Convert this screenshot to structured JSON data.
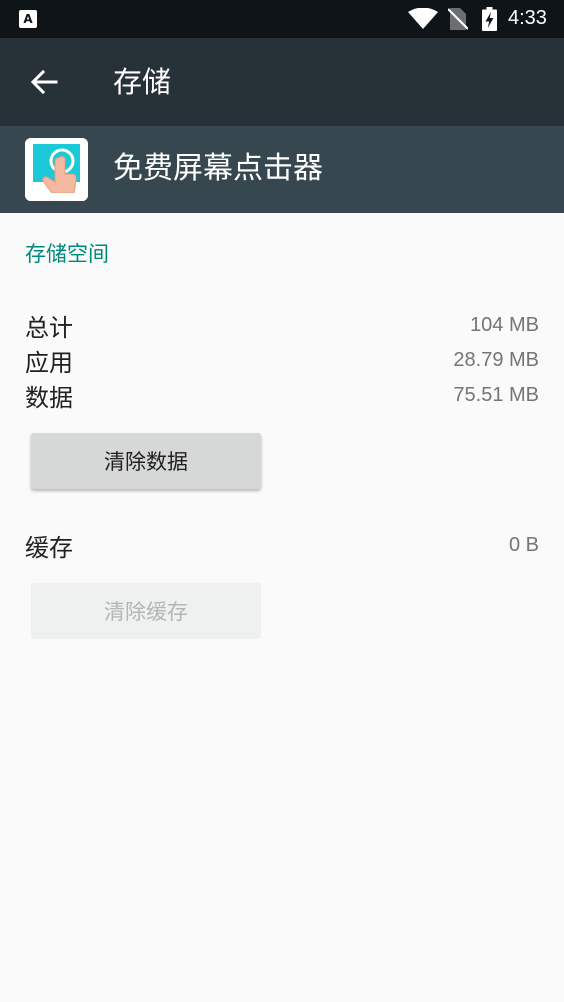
{
  "status_bar": {
    "time": "4:33",
    "notification_letter": "A",
    "icons": [
      "notification-a-icon",
      "wifi-icon",
      "no-sim-icon",
      "battery-charging-icon"
    ]
  },
  "app_bar": {
    "title": "存储",
    "back_icon": "arrow-left-icon"
  },
  "app_header": {
    "app_name": "免费屏幕点击器",
    "app_icon": "tap-hand-app-icon"
  },
  "storage": {
    "section_title": "存储空间",
    "total": {
      "label": "总计",
      "value": "104 MB"
    },
    "app": {
      "label": "应用",
      "value": "28.79 MB"
    },
    "data": {
      "label": "数据",
      "value": "75.51 MB"
    },
    "clear_data_button": "清除数据"
  },
  "cache": {
    "label": "缓存",
    "value": "0 B",
    "clear_cache_button": "清除缓存",
    "clear_cache_enabled": false
  },
  "colors": {
    "status_bar": "#0f1418",
    "app_bar": "#263238",
    "app_header": "#37474f",
    "accent": "#00897b",
    "background": "#fafafa"
  }
}
